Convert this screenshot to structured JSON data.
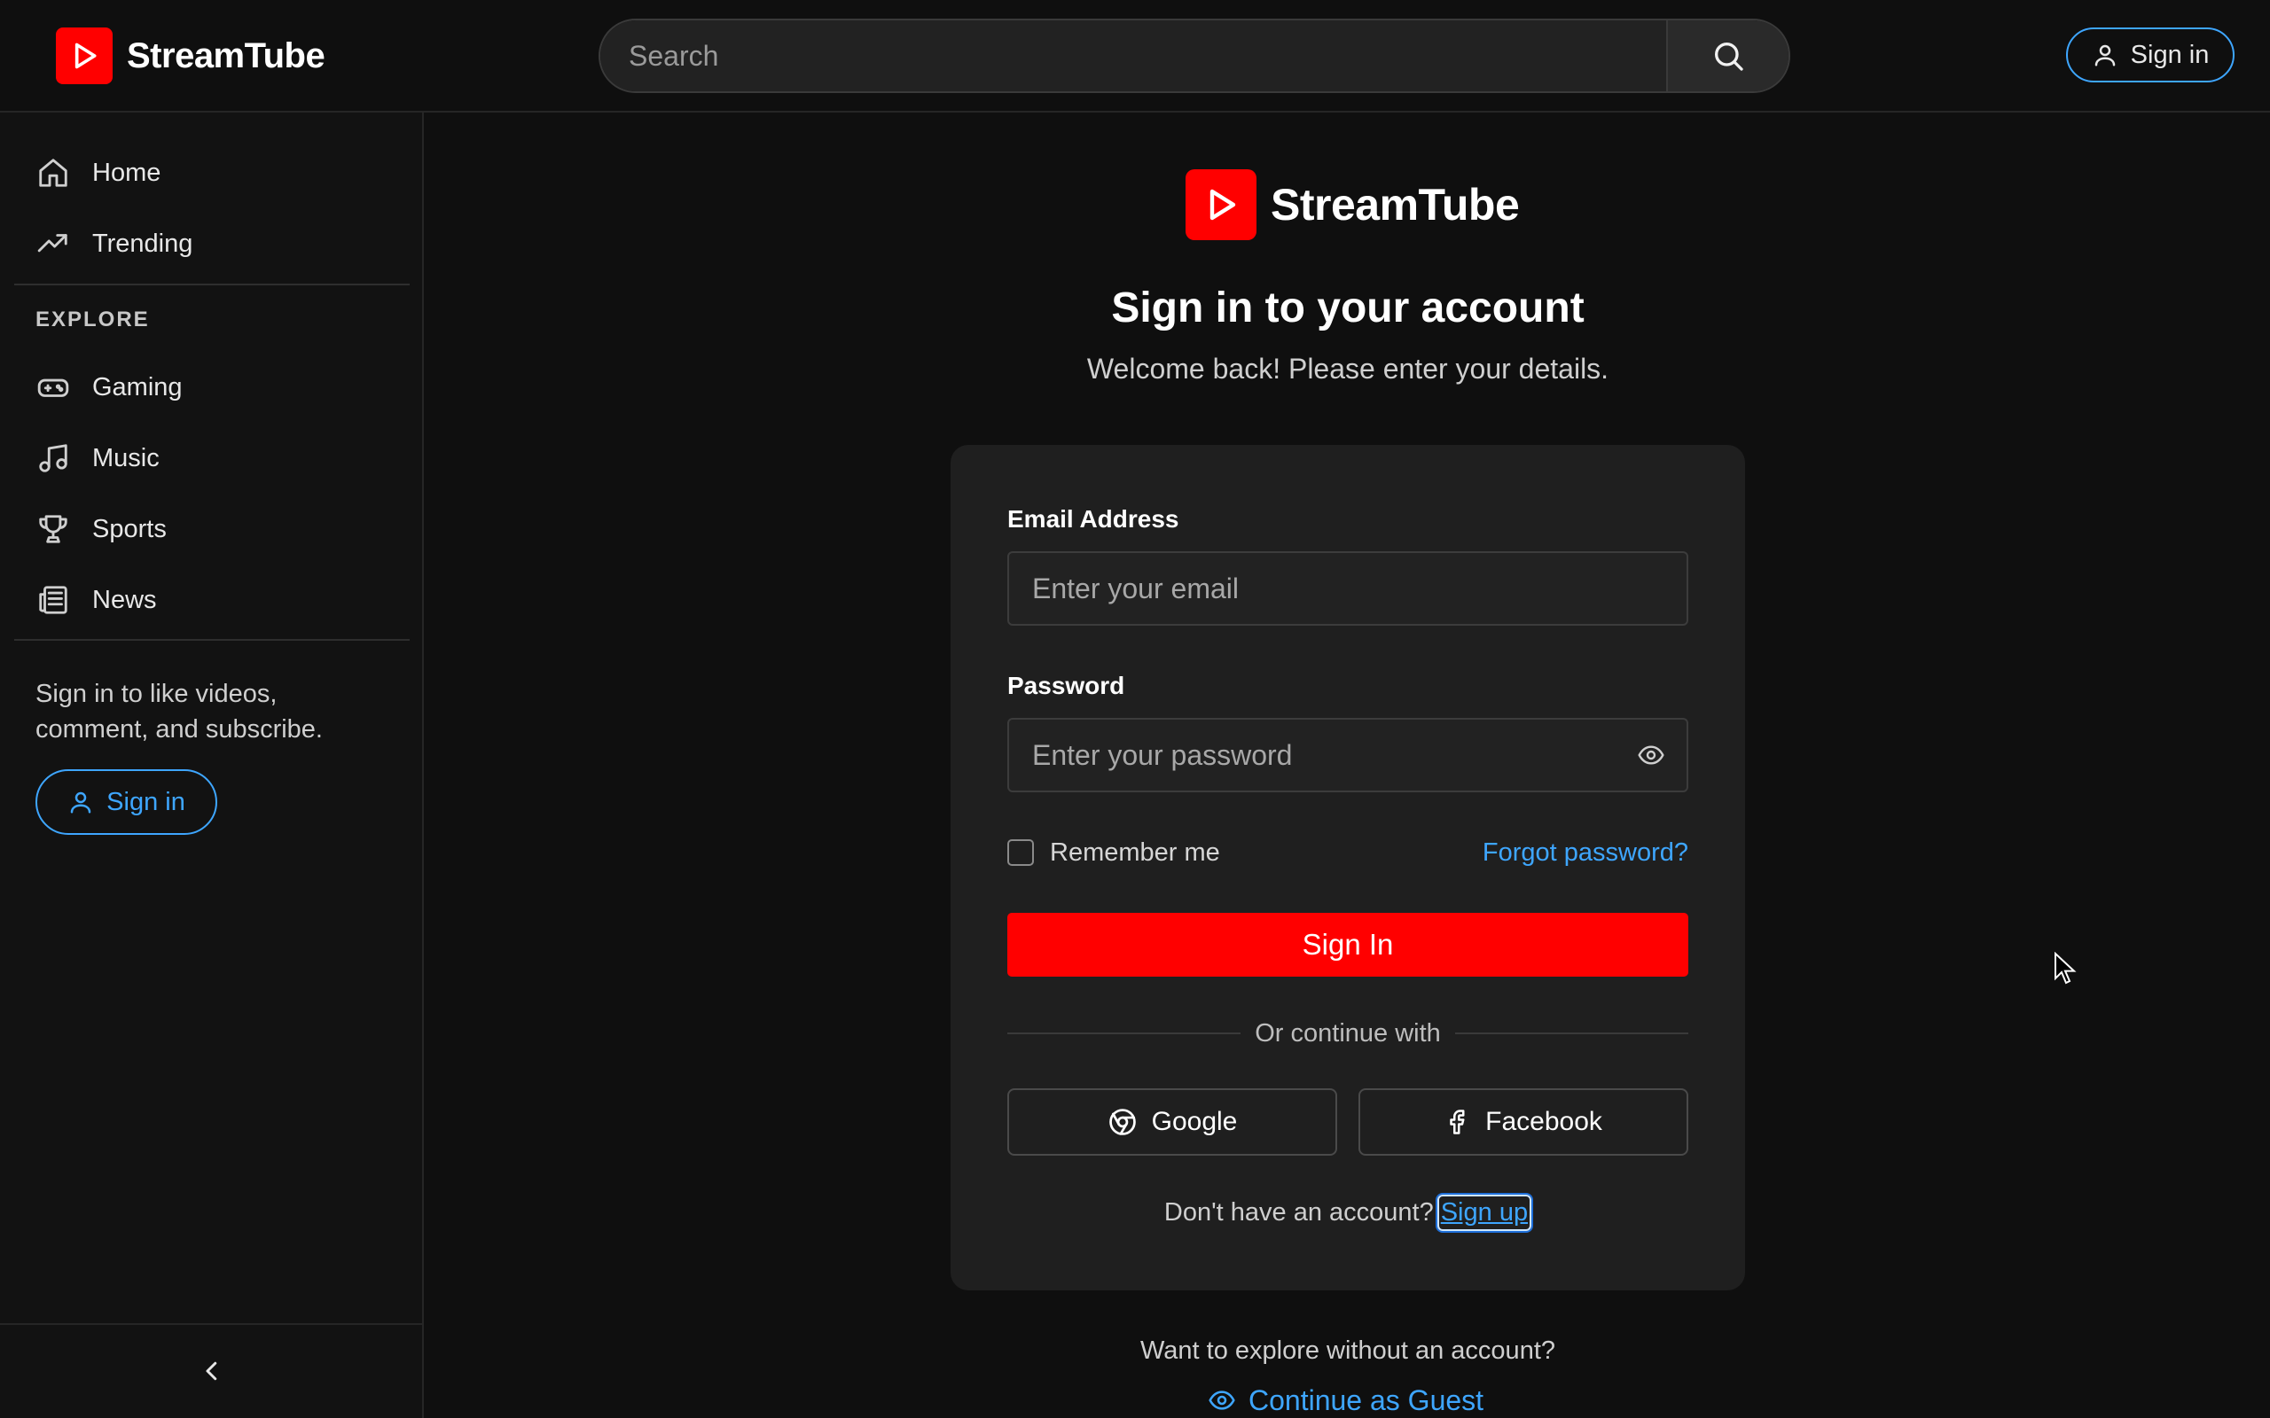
{
  "app": {
    "name": "StreamTube"
  },
  "header": {
    "search": {
      "placeholder": "Search"
    },
    "signin_label": "Sign in"
  },
  "sidebar": {
    "items": [
      {
        "label": "Home",
        "icon": "home-icon"
      },
      {
        "label": "Trending",
        "icon": "trending-icon"
      }
    ],
    "explore_title": "EXPLORE",
    "explore_items": [
      {
        "label": "Gaming",
        "icon": "gamepad-icon"
      },
      {
        "label": "Music",
        "icon": "music-note-icon"
      },
      {
        "label": "Sports",
        "icon": "trophy-icon"
      },
      {
        "label": "News",
        "icon": "newspaper-icon"
      }
    ],
    "signin_message": "Sign in to like videos, comment, and subscribe.",
    "signin_label": "Sign in"
  },
  "login": {
    "title": "Sign in to your account",
    "subtitle": "Welcome back! Please enter your details.",
    "email_label": "Email Address",
    "email_placeholder": "Enter your email",
    "password_label": "Password",
    "password_placeholder": "Enter your password",
    "remember_label": "Remember me",
    "remember_checked": false,
    "forgot_label": "Forgot password?",
    "submit_label": "Sign In",
    "divider_text": "Or continue with",
    "google_label": "Google",
    "facebook_label": "Facebook",
    "no_account_text": "Don't have an account?",
    "signup_label": "Sign up"
  },
  "guest": {
    "prompt": "Want to explore without an account?",
    "link_label": "Continue as Guest"
  },
  "colors": {
    "brand": "#ff0000",
    "accent": "#3ea6ff",
    "background": "#0f0f0f",
    "card": "#1f1f1f"
  }
}
